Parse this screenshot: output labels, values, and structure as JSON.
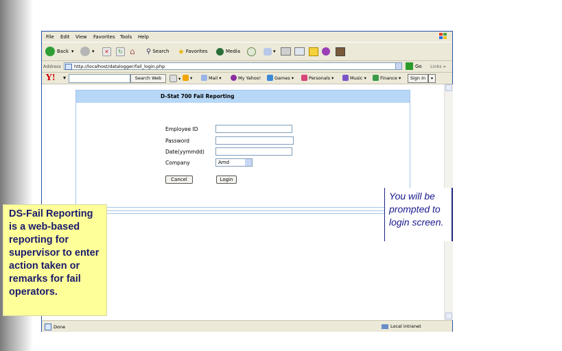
{
  "menu": [
    "File",
    "Edit",
    "View",
    "Favorites",
    "Tools",
    "Help"
  ],
  "toolbar": {
    "back": "Back",
    "search": "Search",
    "favorites": "Favorites",
    "media": "Media"
  },
  "address": {
    "label": "Address",
    "url": "http://localhost/datalogger/fail_login.php",
    "go": "Go",
    "links": "Links"
  },
  "yahoo": {
    "logo": "Y!",
    "search_btn": "Search Web",
    "mail": "Mail",
    "myyahoo": "My Yahoo!",
    "games": "Games",
    "personals": "Personals",
    "music": "Music",
    "finance": "Finance",
    "signin": "Sign In"
  },
  "form": {
    "title": "D-Stat 700 Fail Reporting",
    "employee_label": "Employee ID",
    "password_label": "Password",
    "date_label": "Date(yymmdd)",
    "company_label": "Company",
    "company_value": "Amd",
    "cancel": "Cancel",
    "login": "Login"
  },
  "status": {
    "left": "Done",
    "right": "Local intranet"
  },
  "callout_left": "DS-Fail Reporting is a web-based reporting for supervisor to enter action taken or remarks for fail operators.",
  "callout_right": "You will be prompted to login screen."
}
